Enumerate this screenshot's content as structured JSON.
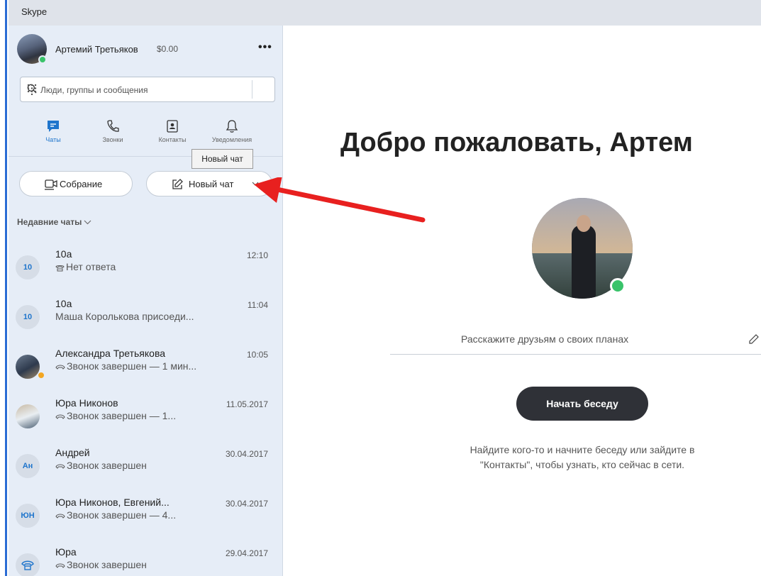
{
  "window": {
    "title": "Skype"
  },
  "profile": {
    "name": "Артемий Третьяков",
    "balance": "$0.00"
  },
  "search": {
    "placeholder": "Люди, группы и сообщения"
  },
  "nav": [
    {
      "label": "Чаты",
      "active": true
    },
    {
      "label": "Звонки"
    },
    {
      "label": "Контакты"
    },
    {
      "label": "Уведомления"
    }
  ],
  "tooltip": "Новый чат",
  "actions": {
    "meeting": "Собрание",
    "new_chat": "Новый чат"
  },
  "recent_header": "Недавние чаты",
  "chats": [
    {
      "avatar": "10",
      "name": "10а",
      "time": "12:10",
      "preview": "Нет ответа",
      "preview_icon": "phone-icon"
    },
    {
      "avatar": "10",
      "name": "10а",
      "time": "11:04",
      "preview": "Маша Королькова присоеди..."
    },
    {
      "avatar": "",
      "name": "Александра Третьякова",
      "time": "10:05",
      "preview": "Звонок завершен — 1 мин...",
      "preview_icon": "call-ended-icon"
    },
    {
      "avatar": "",
      "name": "Юра Никонов",
      "time": "11.05.2017",
      "preview": "Звонок завершен — 1...",
      "preview_icon": "call-ended-icon"
    },
    {
      "avatar": "Ан",
      "name": "Андрей",
      "time": "30.04.2017",
      "preview": "Звонок завершен",
      "preview_icon": "call-ended-icon"
    },
    {
      "avatar": "ЮН",
      "name": "Юра Никонов, Евгений...",
      "time": "30.04.2017",
      "preview": "Звонок завершен — 4...",
      "preview_icon": "call-ended-icon"
    },
    {
      "avatar": "",
      "name": "Юра",
      "time": "29.04.2017",
      "preview": "Звонок завершен",
      "preview_icon": "call-ended-icon"
    }
  ],
  "main": {
    "welcome": "Добро пожаловать, Артем",
    "mood_placeholder": "Расскажите друзьям о своих планах",
    "start_button": "Начать беседу",
    "hint_line1": "Найдите кого-то и начните беседу или зайдите в",
    "hint_line2": "\"Контакты\", чтобы узнать, кто сейчас в сети."
  },
  "colors": {
    "accent": "#1f75cc",
    "presence": "#39c36a",
    "sidebar": "#e6edf7",
    "annotation_arrow": "#e8201f"
  }
}
